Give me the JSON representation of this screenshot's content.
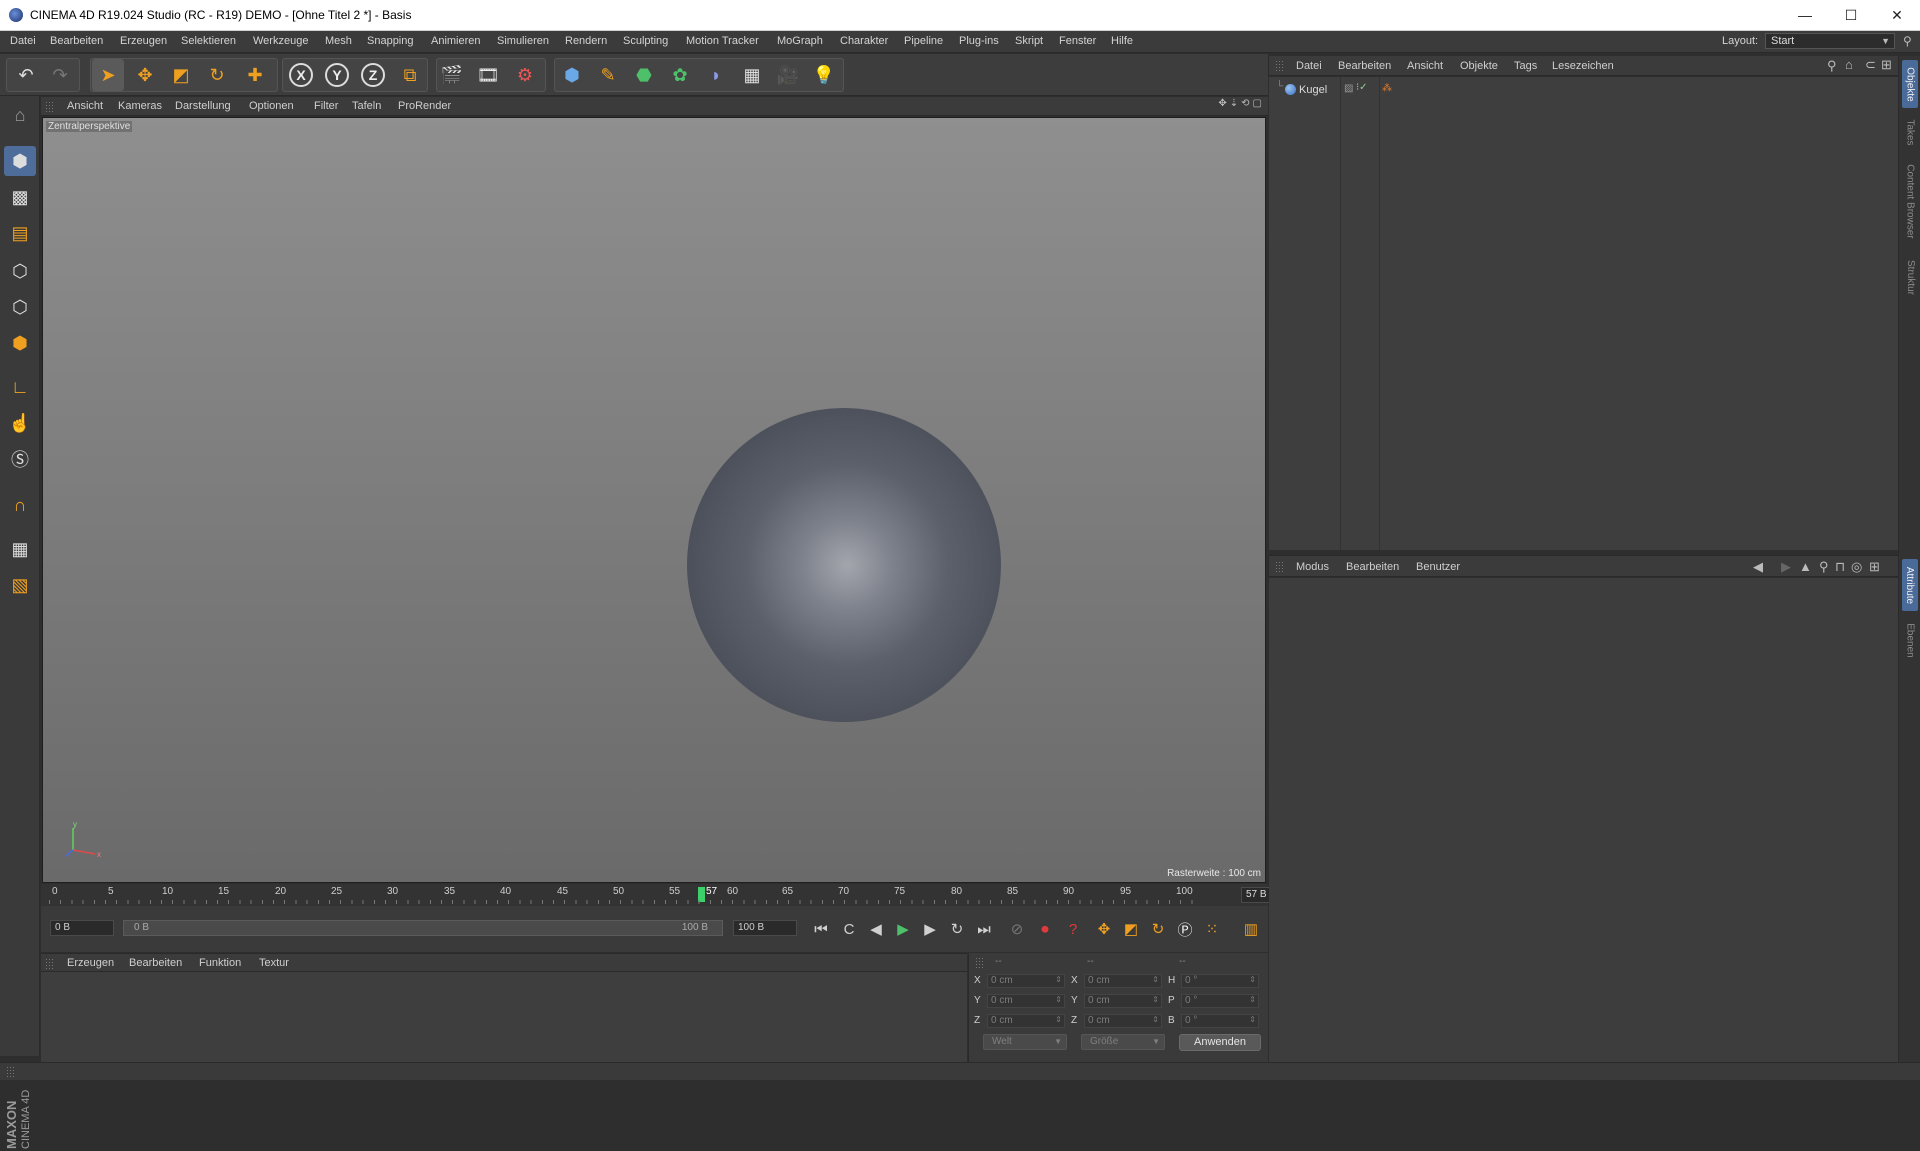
{
  "window": {
    "title": "CINEMA 4D R19.024 Studio (RC - R19) DEMO - [Ohne Titel 2 *] - Basis",
    "minimize": "—",
    "maximize": "☐",
    "close": "✕"
  },
  "menubar": {
    "items": [
      "Datei",
      "Bearbeiten",
      "Erzeugen",
      "Selektieren",
      "Werkzeuge",
      "Mesh",
      "Snapping",
      "Animieren",
      "Simulieren",
      "Rendern",
      "Sculpting",
      "Motion Tracker",
      "MoGraph",
      "Charakter",
      "Pipeline",
      "Plug-ins",
      "Skript",
      "Fenster",
      "Hilfe"
    ],
    "layout_label": "Layout:",
    "layout_value": "Start"
  },
  "toolbar": {
    "axis_x": "X",
    "axis_y": "Y",
    "axis_z": "Z"
  },
  "viewport": {
    "menu": [
      "Ansicht",
      "Kameras",
      "Darstellung",
      "Optionen",
      "Filter",
      "Tafeln",
      "ProRender"
    ],
    "view_label": "Zentralperspektive",
    "grid_info": "Rasterweite : 100 cm",
    "axis_y": "y",
    "axis_x": "x"
  },
  "timeline": {
    "ticks": [
      "0",
      "5",
      "10",
      "15",
      "20",
      "25",
      "30",
      "35",
      "40",
      "45",
      "50",
      "55",
      "57",
      "60",
      "65",
      "70",
      "75",
      "80",
      "85",
      "90",
      "95",
      "100"
    ],
    "current_frame": "57 B",
    "start_field": "0 B",
    "range_start": "0 B",
    "range_end": "100 B",
    "end_field": "100 B"
  },
  "material_manager": {
    "menu": [
      "Erzeugen",
      "Bearbeiten",
      "Funktion",
      "Textur"
    ]
  },
  "coordinates": {
    "header": [
      "--",
      "--",
      "--"
    ],
    "rows": [
      {
        "pos_label": "X",
        "pos_value": "0 cm",
        "size_label": "X",
        "size_value": "0 cm",
        "rot_label": "H",
        "rot_value": "0 °"
      },
      {
        "pos_label": "Y",
        "pos_value": "0 cm",
        "size_label": "Y",
        "size_value": "0 cm",
        "rot_label": "P",
        "rot_value": "0 °"
      },
      {
        "pos_label": "Z",
        "pos_value": "0 cm",
        "size_label": "Z",
        "size_value": "0 cm",
        "rot_label": "B",
        "rot_value": "0 °"
      }
    ],
    "space_dropdown": "Welt",
    "size_dropdown": "Größe",
    "apply_label": "Anwenden"
  },
  "object_manager": {
    "menu": [
      "Datei",
      "Bearbeiten",
      "Ansicht",
      "Objekte",
      "Tags",
      "Lesezeichen"
    ],
    "objects": [
      {
        "name": "Kugel"
      }
    ]
  },
  "attribute_manager": {
    "menu": [
      "Modus",
      "Bearbeiten",
      "Benutzer"
    ]
  },
  "right_tabs": {
    "top": [
      "Objekte",
      "Takes",
      "Content Browser",
      "Struktur"
    ],
    "bottom": [
      "Attribute",
      "Ebenen"
    ]
  },
  "logo": {
    "brand": "MAXON",
    "product": "CINEMA 4D"
  },
  "colors": {
    "accent_orange": "#f0a020",
    "playhead_green": "#3cd16b",
    "ui_background": "#3d3d3d"
  }
}
